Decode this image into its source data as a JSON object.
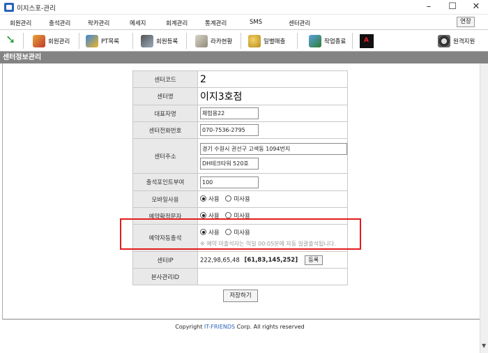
{
  "window": {
    "title": "이지스포-관리",
    "minimize": "–",
    "maximize": "☐",
    "close": "✕"
  },
  "menu": {
    "items": [
      "회원관리",
      "출석관리",
      "락카관리",
      "메세지",
      "회계관리",
      "통계관리",
      "SMS",
      "센터관리"
    ],
    "extend_button": "연장"
  },
  "toolbar": {
    "items": [
      {
        "label": "회원관리",
        "icon": "members-icon"
      },
      {
        "label": "PT목록",
        "icon": "pt-icon"
      },
      {
        "label": "회원등록",
        "icon": "register-icon"
      },
      {
        "label": "라카현황",
        "icon": "locker-icon"
      },
      {
        "label": "일별매출",
        "icon": "sales-icon"
      },
      {
        "label": "작업종료",
        "icon": "exit-icon"
      }
    ],
    "remote_label": "원격지원"
  },
  "section": {
    "title": "센터정보관리"
  },
  "form": {
    "center_code": {
      "label": "센터코드",
      "value": "2"
    },
    "center_name": {
      "label": "센터명",
      "value": "이지3호점"
    },
    "representative": {
      "label": "대표자명",
      "value": "체험용22"
    },
    "phone": {
      "label": "센터전화번호",
      "value": "070-7536-2795"
    },
    "address": {
      "label": "센터주소",
      "line1": "경기 수원시 권선구 고색동 1094번지",
      "line2": "DH테크타워 520호"
    },
    "attendance_points": {
      "label": "출석포인트부여",
      "value": "100"
    },
    "mobile_use": {
      "label": "모바일사용",
      "option_yes": "사용",
      "option_no": "미사용",
      "selected": "사용"
    },
    "reservation_sms": {
      "label": "예약확정문자",
      "option_yes": "사용",
      "option_no": "미사용",
      "selected": "사용"
    },
    "auto_attendance": {
      "label": "예약자동출석",
      "option_yes": "사용",
      "option_no": "미사용",
      "selected": "사용",
      "note": "※ 예약 미출석자는 익일 00:05분에 자동 일괄출석됩니다."
    },
    "center_ip": {
      "label": "센터IP",
      "value": "222,98,65,48",
      "bold_value": "[61,83,145,252]",
      "button": "등록"
    },
    "hq_id": {
      "label": "본사관리ID",
      "value": ""
    }
  },
  "save_button": "저장하기",
  "footer": {
    "prefix": "Copyright ",
    "brand": "IT-FRIENDS",
    "suffix": " Corp.  All rights reserved"
  },
  "colors": {
    "section_header": "#838383",
    "highlight": "#e41b1b",
    "brand": "#2a64b8"
  }
}
